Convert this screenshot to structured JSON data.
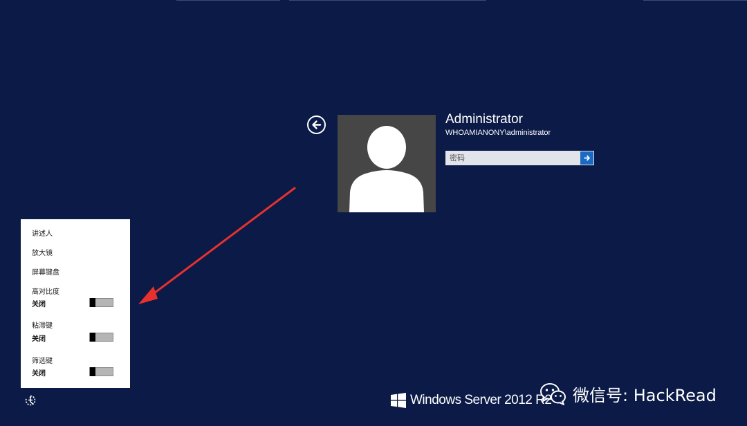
{
  "user": {
    "name": "Administrator",
    "account": "WHOAMIANONY\\administrator"
  },
  "password": {
    "placeholder": "密码"
  },
  "ease_menu": {
    "items": [
      {
        "label": "讲述人"
      },
      {
        "label": "放大镜"
      },
      {
        "label": "屏幕键盘"
      },
      {
        "label": "高对比度",
        "state": "关闭",
        "toggle_on": false
      },
      {
        "label": "粘滞键",
        "state": "关闭",
        "toggle_on": false
      },
      {
        "label": "筛选键",
        "state": "关闭",
        "toggle_on": false
      }
    ]
  },
  "branding": {
    "product": "Windows Server 2012 R2"
  },
  "watermark": {
    "text": "微信号: HackRead"
  },
  "colors": {
    "background": "#0b1a46",
    "avatar_bg": "#464646",
    "submit_button": "#1a6ac4",
    "annotation_arrow": "#e8312e"
  },
  "icons": {
    "back": "back-arrow-icon",
    "submit": "submit-arrow-icon",
    "ease_of_access": "ease-of-access-icon",
    "windows_logo": "windows-logo-icon",
    "wechat": "wechat-icon"
  }
}
